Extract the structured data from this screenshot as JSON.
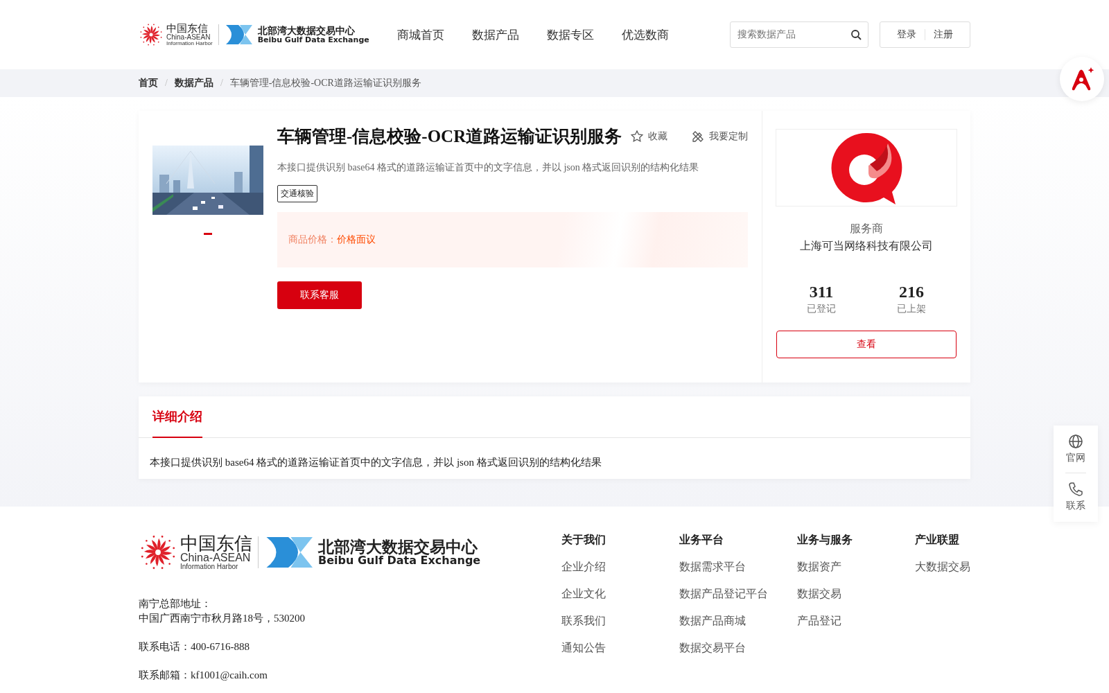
{
  "header": {
    "logo": {
      "cn": "中国东信",
      "en1": "China-ASEAN",
      "en2": "Information Harbor",
      "exchange_cn": "北部湾大数据交易中心",
      "exchange_en": "Beibu Gulf Data Exchange"
    },
    "nav": [
      "商城首页",
      "数据产品",
      "数据专区",
      "优选数商"
    ],
    "search": {
      "placeholder": "搜索数据产品"
    },
    "auth": [
      "登录",
      "注册"
    ]
  },
  "breadcrumb": [
    "首页",
    "数据产品",
    "车辆管理-信息校验-OCR道路运输证识别服务"
  ],
  "breadcrumb_separator": "/",
  "product": {
    "title": "车辆管理-信息校验-OCR道路运输证识别服务",
    "actions": [
      {
        "label": "收藏",
        "kind": "favorite"
      },
      {
        "label": "我要定制",
        "kind": "customize"
      }
    ],
    "description": "本接口提供识别 base64 格式的道路运输证首页中的文字信息，并以 json 格式返回识别的结构化结果",
    "tags": [
      "交通核验"
    ],
    "image": {
      "kind": "picture"
    },
    "slides": [
      {
        "selected": true
      }
    ],
    "price_label": "商品价格：",
    "price_value": "价格面议",
    "contact_button": "联系客服"
  },
  "provider": {
    "role": "服务商",
    "name": "上海可当网络科技有限公司",
    "stats": [
      {
        "value": "311",
        "label": "已登记"
      },
      {
        "value": "216",
        "label": "已上架"
      }
    ],
    "button": "查看"
  },
  "detail": {
    "tabs": [
      {
        "label": "详细介绍",
        "selected": true
      }
    ],
    "text": "本接口提供识别 base64 格式的道路运输证首页中的文字信息，并以 json 格式返回识别的结构化结果"
  },
  "footer": {
    "logo": {
      "cn": "中国东信",
      "en1": "China-ASEAN",
      "en2": "Information Harbor",
      "exchange_cn": "北部湾大数据交易中心",
      "exchange_en": "Beibu Gulf Data Exchange"
    },
    "address_label": "南宁总部地址：",
    "address": "中国广西南宁市秋月路18号，530200",
    "phone": "联系电话：400-6716-888",
    "email": "联系邮箱：kf1001@caih.com",
    "columns": [
      {
        "title": "关于我们",
        "links": [
          "企业介绍",
          "企业文化",
          "联系我们",
          "通知公告"
        ]
      },
      {
        "title": "业务平台",
        "links": [
          "数据需求平台",
          "数据产品登记平台",
          "数据产品商城",
          "数据交易平台"
        ]
      },
      {
        "title": "业务与服务",
        "links": [
          "数据资产",
          "数据交易",
          "产品登记"
        ]
      },
      {
        "title": "产业联盟",
        "links": [
          "大数据交易"
        ]
      }
    ]
  },
  "side_tools": [
    {
      "label": "官网",
      "kind": "globe"
    },
    {
      "label": "联系",
      "kind": "phone"
    }
  ]
}
